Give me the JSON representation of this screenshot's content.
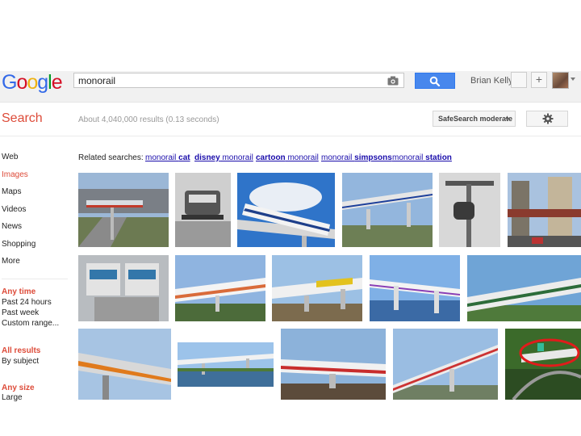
{
  "header": {
    "logo_text": "Google",
    "search_value": "monorail",
    "user_name": "Brian Kelly",
    "share_label": "+"
  },
  "toolbar": {
    "search_label": "Search",
    "result_stats": "About 4,040,000 results (0.13 seconds)",
    "safesearch_label": "SafeSearch moderate"
  },
  "sidebar": {
    "items": [
      "Web",
      "Images",
      "Maps",
      "Videos",
      "News",
      "Shopping",
      "More"
    ],
    "active_item": "Images",
    "time": {
      "title": "Any time",
      "options": [
        "Past 24 hours",
        "Past week",
        "Custom range..."
      ]
    },
    "results": {
      "title": "All results",
      "options": [
        "By subject"
      ]
    },
    "size": {
      "title": "Any size",
      "options": [
        "Large"
      ]
    }
  },
  "related": {
    "label": "Related searches:",
    "items": [
      {
        "prefix": "monorail ",
        "bold": "cat"
      },
      {
        "prefix": "",
        "bold": "disney",
        "suffix": " monorail"
      },
      {
        "prefix": "",
        "bold": "cartoon",
        "suffix": " monorail"
      },
      {
        "prefix": "monorail ",
        "bold": "simpsons"
      },
      {
        "prefix": "monorail ",
        "bold": "station"
      }
    ]
  },
  "colors": {
    "accent_red": "#dd4b39",
    "link_blue": "#1a0dab",
    "search_button_blue": "#4787ed",
    "highlight_circle": "#e21b1b"
  },
  "image_results": {
    "count": 17,
    "icon_names": [
      "camera-icon",
      "magnifier-icon",
      "gear-icon"
    ]
  }
}
